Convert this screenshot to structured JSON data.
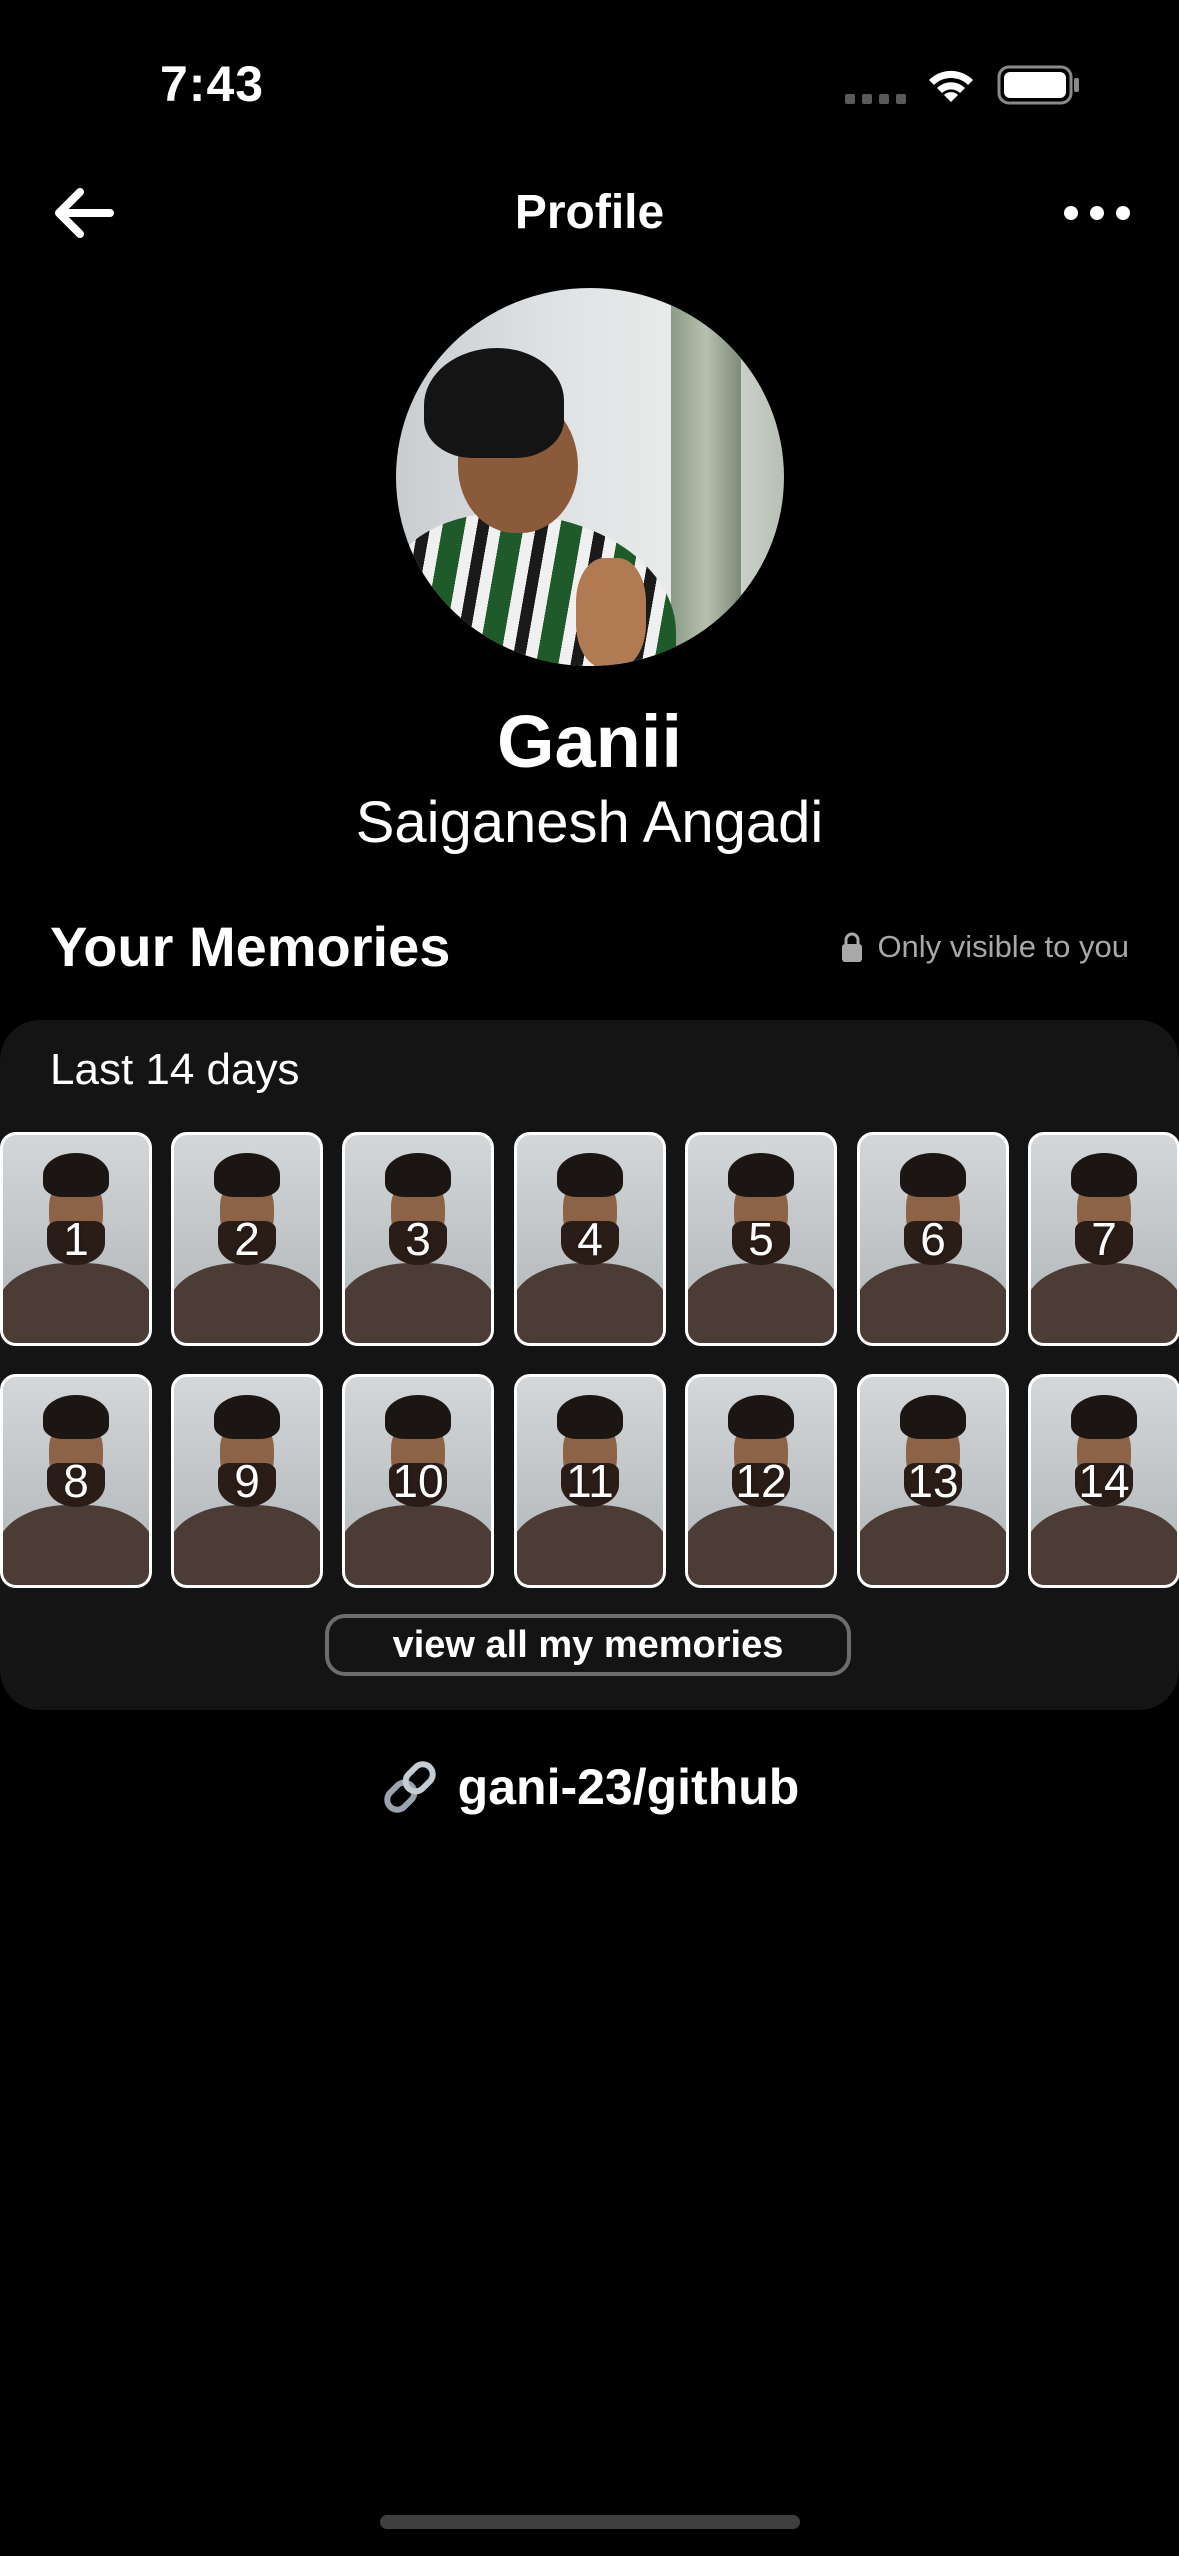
{
  "status_bar": {
    "time": "7:43",
    "wifi_icon": "wifi-icon",
    "battery_icon": "battery-full-icon"
  },
  "nav": {
    "back_icon": "arrow-left-icon",
    "title": "Profile",
    "more_icon": "more-horizontal-icon"
  },
  "profile": {
    "display_name": "Ganii",
    "full_name": "Saiganesh Angadi"
  },
  "memories": {
    "title": "Your Memories",
    "privacy_icon": "lock-icon",
    "privacy_note": "Only visible to you",
    "period_label": "Last 14 days",
    "days": [
      "1",
      "2",
      "3",
      "4",
      "5",
      "6",
      "7",
      "8",
      "9",
      "10",
      "11",
      "12",
      "13",
      "14"
    ],
    "view_all_label": "view all my memories"
  },
  "link": {
    "icon": "link-icon",
    "text": "gani-23/github"
  },
  "colors": {
    "background": "#000000",
    "card": "#141414",
    "text_primary": "#ffffff",
    "text_secondary": "#a8a8a8",
    "button_border": "#6c6c6c"
  }
}
